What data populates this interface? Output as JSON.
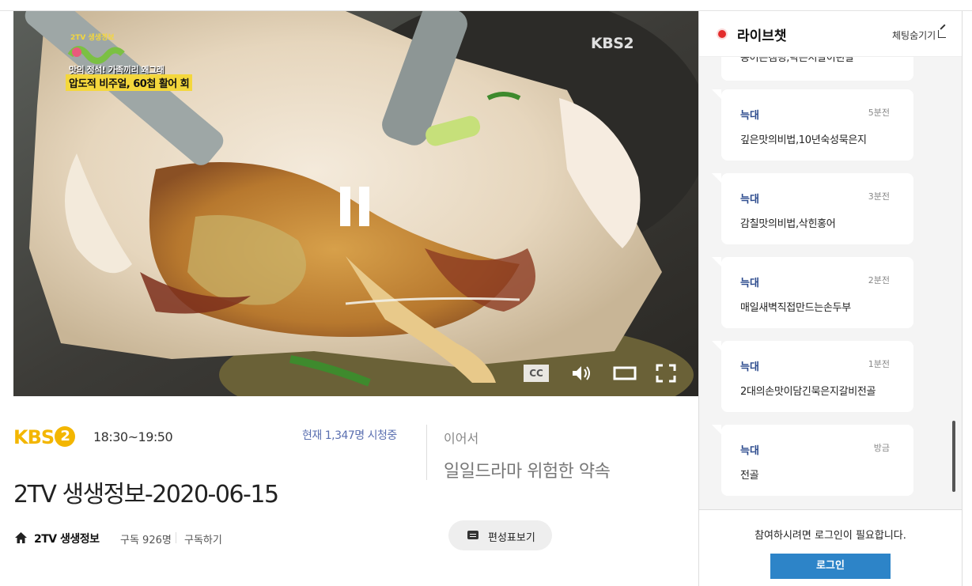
{
  "video": {
    "overlay_logo": "2TV 생생정보",
    "overlay_caption_small": "맛의 정석! 가족끼리 왜그래",
    "overlay_caption_big": "압도적 비주얼, 60첩 활어 회",
    "channel_mark": "KBS2",
    "cc_label": "CC"
  },
  "program": {
    "channel_logo": "KBS",
    "channel_logo_num": "2",
    "time": "18:30~19:50",
    "viewers": "현재 1,347명 시청중",
    "title": "2TV 생생정보-2020-06-15",
    "next_label": "이어서",
    "next_title": "일일드라마 위험한 약속",
    "name": "2TV 생생정보",
    "subscribers": "구독 926명",
    "subscribe_label": "구독하기",
    "schedule_label": "편성표보기"
  },
  "chat": {
    "title": "라이브챗",
    "hide_label": "체팅숨기기",
    "partial_text": "농어튼캠핑,탁튼저갈이린갈",
    "messages": [
      {
        "nick": "늑대",
        "ago": "5분전",
        "text": "깊은맛의비법,10년숙성묵은지"
      },
      {
        "nick": "늑대",
        "ago": "3분전",
        "text": "감칠맛의비법,삭힌홍어"
      },
      {
        "nick": "늑대",
        "ago": "2분전",
        "text": "매일새벽직접만드는손두부"
      },
      {
        "nick": "늑대",
        "ago": "1분전",
        "text": "2대의손맛이담긴묵은지갈비전골"
      },
      {
        "nick": "늑대",
        "ago": "방금",
        "text": "전골"
      }
    ],
    "login_message": "참여하시려면 로그인이 필요합니다.",
    "login_label": "로그인"
  },
  "colors": {
    "accent_blue": "#2d84c8",
    "kbs_yellow": "#f3b600",
    "nick_blue": "#2b4a8d",
    "live_red": "#e32c2c"
  }
}
